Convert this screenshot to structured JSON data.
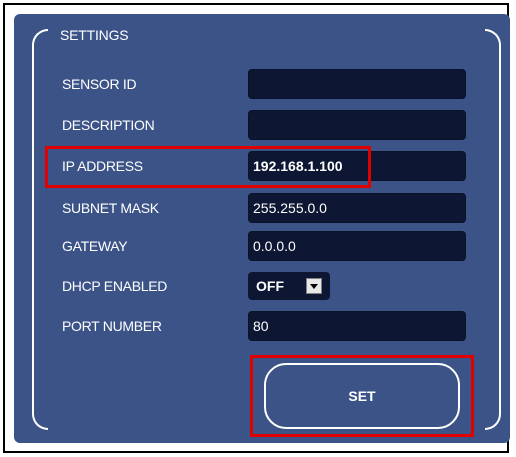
{
  "section_title": "SETTINGS",
  "fields": {
    "sensor_id": {
      "label": "SENSOR ID",
      "value": ""
    },
    "description": {
      "label": "DESCRIPTION",
      "value": ""
    },
    "ip_address": {
      "label": "IP ADDRESS",
      "value": "192.168.1.100"
    },
    "subnet_mask": {
      "label": "SUBNET MASK",
      "value": "255.255.0.0"
    },
    "gateway": {
      "label": "GATEWAY",
      "value": "0.0.0.0"
    },
    "dhcp_enabled": {
      "label": "DHCP ENABLED",
      "value": "OFF"
    },
    "port_number": {
      "label": "PORT NUMBER",
      "value": "80"
    }
  },
  "set_button_label": "SET",
  "colors": {
    "panel": "#3c5388",
    "field_background": "#0d1733",
    "highlight": "#e00000",
    "text": "#ffffff"
  }
}
